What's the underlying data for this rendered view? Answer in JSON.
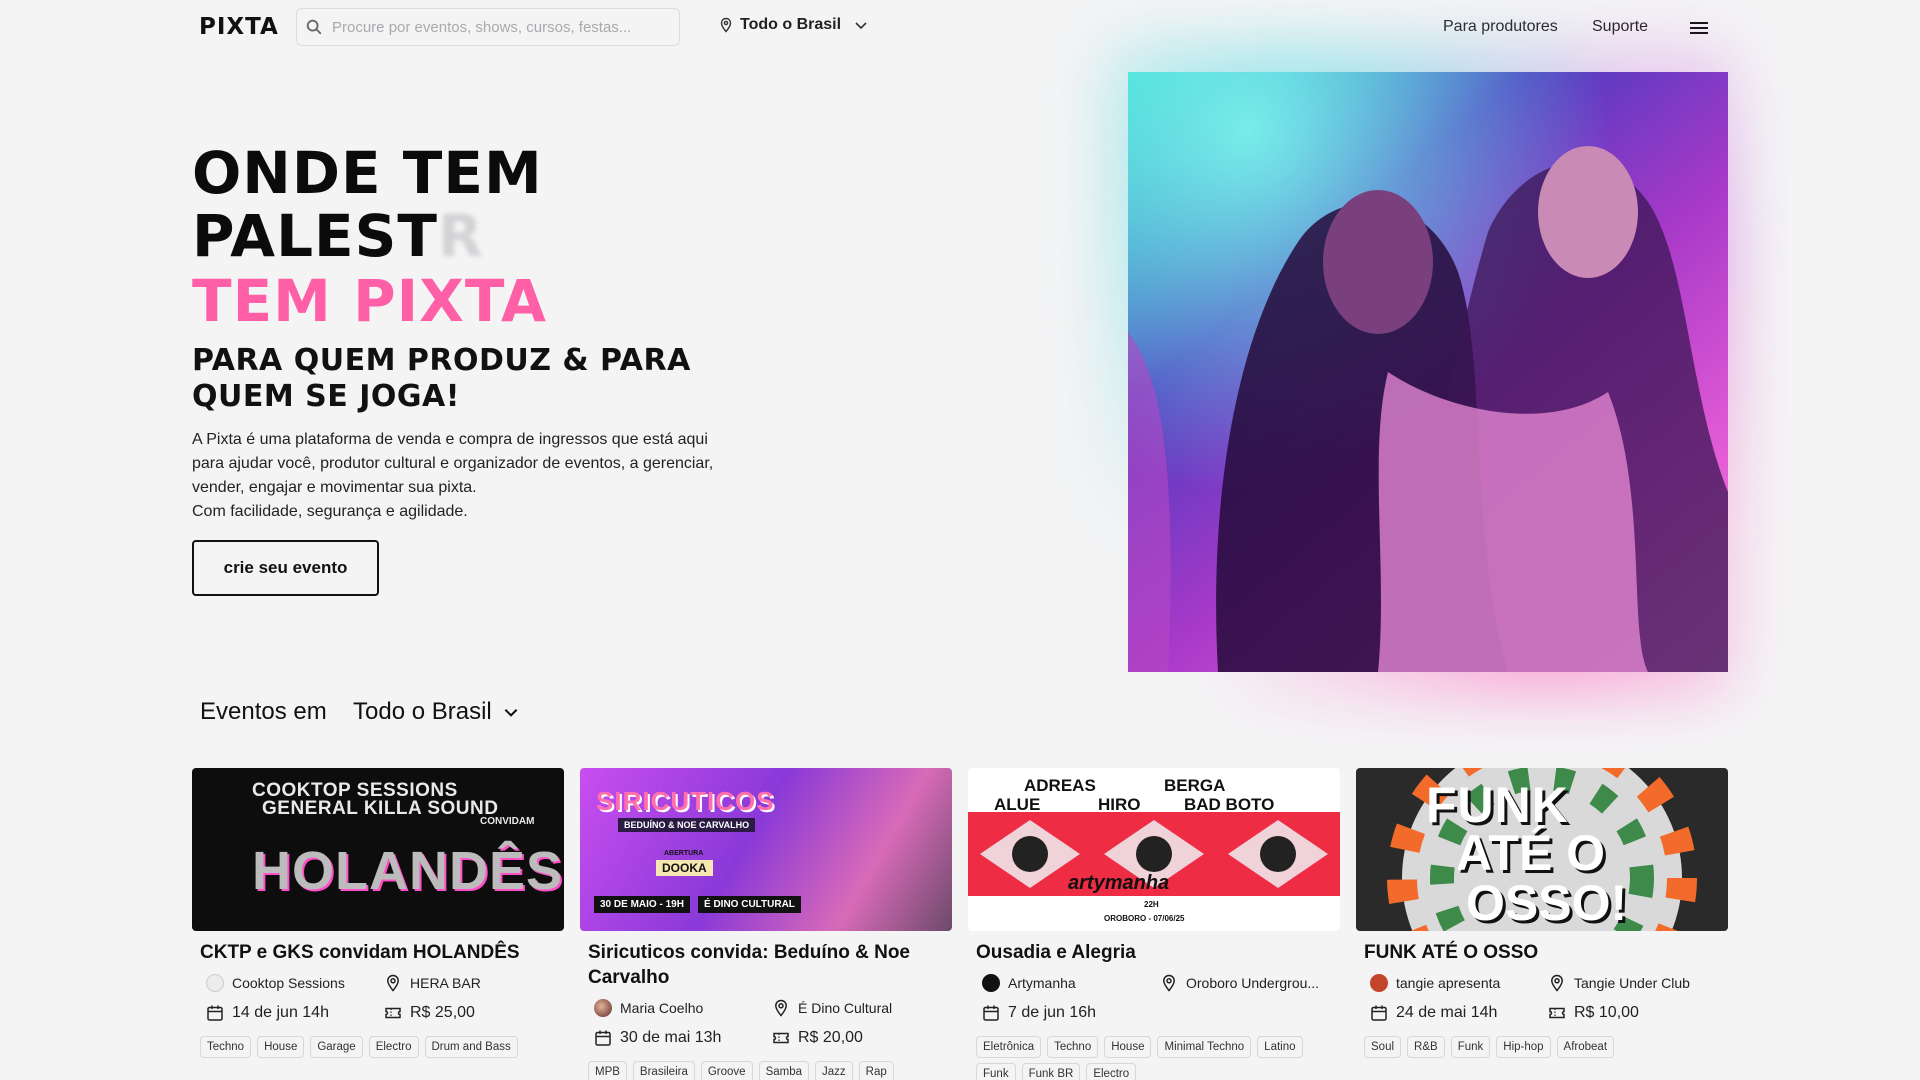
{
  "header": {
    "logo": "PIXTA",
    "search_placeholder": "Procure por eventos, shows, cursos, festas...",
    "location": "Todo o Brasil",
    "nav": [
      "Para produtores",
      "Suporte"
    ]
  },
  "hero": {
    "line1": "ONDE TEM",
    "line2_visible": "PALEST",
    "line2_fading": "R",
    "line3": "TEM PIXTA",
    "subtitle": "PARA QUEM PRODUZ & PARA QUEM SE JOGA!",
    "description_lines": [
      "A Pixta é uma plataforma de venda e compra de ingressos que está aqui",
      "para ajudar você, produtor cultural e organizador de eventos, a gerenciar,",
      "vender, engajar e movimentar sua pixta.",
      "Com facilidade, segurança e agilidade."
    ],
    "cta": "crie seu evento"
  },
  "events_section": {
    "title": "Eventos em",
    "location": "Todo o Brasil"
  },
  "events": [
    {
      "title": "CKTP e GKS convidam HOLANDÊS",
      "organizer": "Cooktop Sessions",
      "venue": "HERA BAR",
      "date": "14 de jun 14h",
      "price": "R$ 25,00",
      "tags": [
        "Techno",
        "House",
        "Garage",
        "Electro",
        "Drum and Bass"
      ],
      "flyer_text": [
        "COOKTOP SESSIONS",
        "GENERAL KILLA SOUND",
        "CONVIDAM",
        "HOLANDÊS"
      ]
    },
    {
      "title": "Siricuticos convida: Beduíno & Noe Carvalho",
      "organizer": "Maria Coelho",
      "venue": "É Dino Cultural",
      "date": "30 de mai 13h",
      "price": "R$ 20,00",
      "tags": [
        "MPB",
        "Brasileira",
        "Groove",
        "Samba",
        "Jazz",
        "Rap"
      ],
      "flyer_text": [
        "SIRICUTICOS",
        "BEDUÍNO & NOE CARVALHO",
        "ABERTURA",
        "DOOKA",
        "30 DE MAIO - 19H",
        "É DINO CULTURAL"
      ]
    },
    {
      "title": "Ousadia e Alegria",
      "organizer": "Artymanha",
      "venue": "Oroboro Undergrou...",
      "date": "7 de jun 16h",
      "price": "",
      "tags": [
        "Eletrônica",
        "Techno",
        "House",
        "Minimal Techno",
        "Latino",
        "Funk",
        "Funk BR",
        "Electro"
      ],
      "flyer_text": [
        "ADREAS",
        "ALUE",
        "HIRO",
        "BERGA",
        "BAD BOTO",
        "artymanha",
        "22H",
        "OROBORO - 07/06/25"
      ]
    },
    {
      "title": "FUNK ATÉ O OSSO",
      "organizer": "tangie apresenta",
      "venue": "Tangie Under Club",
      "date": "24 de mai 14h",
      "price": "R$ 10,00",
      "tags": [
        "Soul",
        "R&B",
        "Funk",
        "Hip-hop",
        "Afrobeat"
      ],
      "flyer_text": [
        "FUNK",
        "ATÉ O",
        "OSSO!"
      ]
    }
  ],
  "colors": {
    "accent_pink": "#ff5fa6",
    "background": "#f4f4f5"
  }
}
